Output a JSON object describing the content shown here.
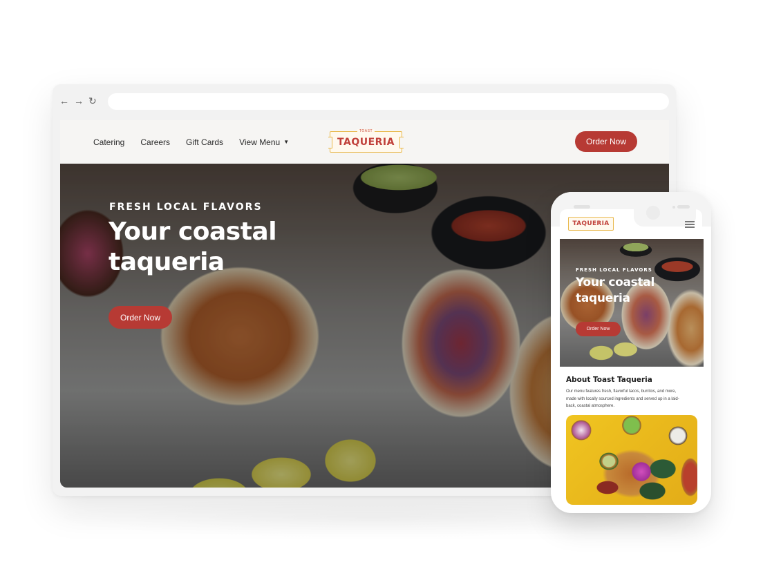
{
  "browser": {
    "nav": {
      "back_icon": "←",
      "forward_icon": "→",
      "reload_icon": "↻"
    },
    "address": ""
  },
  "site": {
    "nav_links": [
      "Catering",
      "Careers",
      "Gift Cards",
      "View Menu"
    ],
    "dropdown_caret": "▼",
    "logo": {
      "small": "TOAST",
      "text": "TAQUERIA"
    },
    "header_order_button": "Order Now",
    "hero": {
      "eyebrow": "FRESH LOCAL FLAVORS",
      "title": "Your coastal taqueria",
      "button": "Order Now"
    }
  },
  "mobile": {
    "logo_text": "TAQUERIA",
    "hero": {
      "eyebrow": "FRESH LOCAL FLAVORS",
      "title": "Your coastal taqueria",
      "button": "Order Now"
    },
    "about": {
      "title": "About Toast Taqueria",
      "text": "Our menu features fresh, flavorful tacos, burritos, and more, made with locally sourced ingredients and served up in a laid-back, coastal atmosphere."
    }
  },
  "colors": {
    "accent": "#b73a34",
    "logo_red": "#c0403a",
    "logo_gold": "#e8b84a",
    "header_bg": "#f6f5f3"
  }
}
